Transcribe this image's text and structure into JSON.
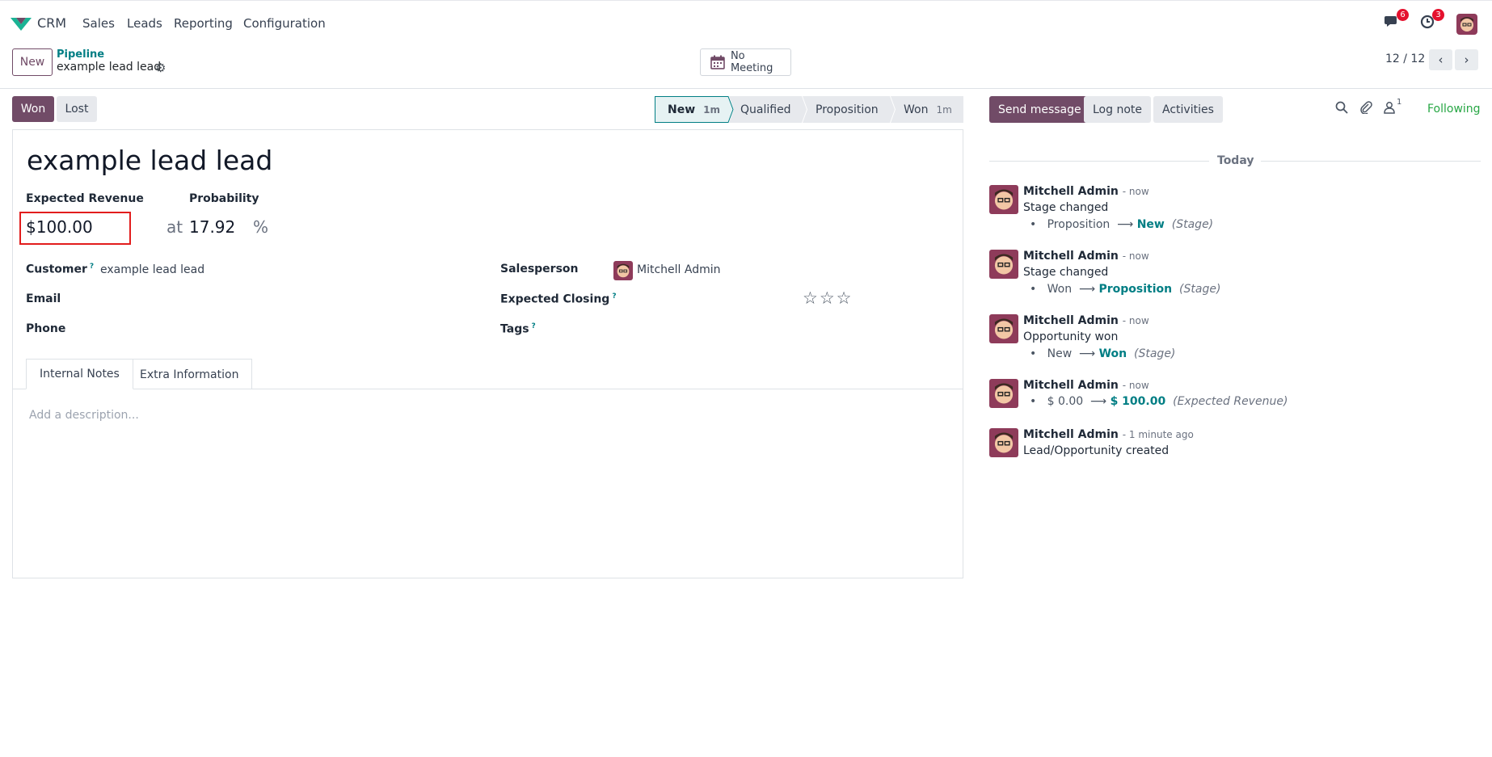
{
  "navbar": {
    "app_name": "CRM",
    "menu": [
      "Sales",
      "Leads",
      "Reporting",
      "Configuration"
    ],
    "messages_count": "6",
    "activities_count": "3"
  },
  "control_panel": {
    "new_label": "New",
    "breadcrumb_parent": "Pipeline",
    "breadcrumb_current": "example lead lead",
    "meeting_label": "No Meeting",
    "pager": "12 / 12"
  },
  "statusbar": {
    "won_label": "Won",
    "lost_label": "Lost",
    "stages": [
      {
        "label": "New",
        "duration": "1m"
      },
      {
        "label": "Qualified",
        "duration": ""
      },
      {
        "label": "Proposition",
        "duration": ""
      },
      {
        "label": "Won",
        "duration": "1m"
      }
    ],
    "active_stage": "New"
  },
  "form": {
    "title": "example lead lead",
    "expected_revenue_label": "Expected Revenue",
    "expected_revenue": "$100.00",
    "probability_label": "Probability",
    "at_label": "at",
    "probability": "17.92",
    "percent": "%",
    "customer_label": "Customer",
    "customer": "example lead lead",
    "email_label": "Email",
    "phone_label": "Phone",
    "salesperson_label": "Salesperson",
    "salesperson": "Mitchell Admin",
    "expected_closing_label": "Expected Closing",
    "tags_label": "Tags",
    "help_marker": "?",
    "priority_stars": 0,
    "tabs": [
      "Internal Notes",
      "Extra Information"
    ],
    "description_placeholder": "Add a description..."
  },
  "chatter": {
    "send_message": "Send message",
    "log_note": "Log note",
    "activities": "Activities",
    "followers_count": "1",
    "following": "Following",
    "date_separator": "Today",
    "messages": [
      {
        "author": "Mitchell Admin",
        "time": "- now",
        "body": "Stage changed",
        "old": "Proposition",
        "new": "New",
        "field": "(Stage)"
      },
      {
        "author": "Mitchell Admin",
        "time": "- now",
        "body": "Stage changed",
        "old": "Won",
        "new": "Proposition",
        "field": "(Stage)"
      },
      {
        "author": "Mitchell Admin",
        "time": "- now",
        "body": "Opportunity won",
        "old": "New",
        "new": "Won",
        "field": "(Stage)"
      },
      {
        "author": "Mitchell Admin",
        "time": "- now",
        "body": "",
        "old": "$ 0.00",
        "new": "$ 100.00",
        "field": "(Expected Revenue)"
      },
      {
        "author": "Mitchell Admin",
        "time": "- 1 minute ago",
        "body": "Lead/Opportunity created",
        "old": "",
        "new": "",
        "field": ""
      }
    ]
  },
  "colors": {
    "brand": "#714b67",
    "link": "#017e84",
    "following": "#28a745",
    "badge": "#e5112e",
    "highlight_box": "#e21d1d"
  }
}
